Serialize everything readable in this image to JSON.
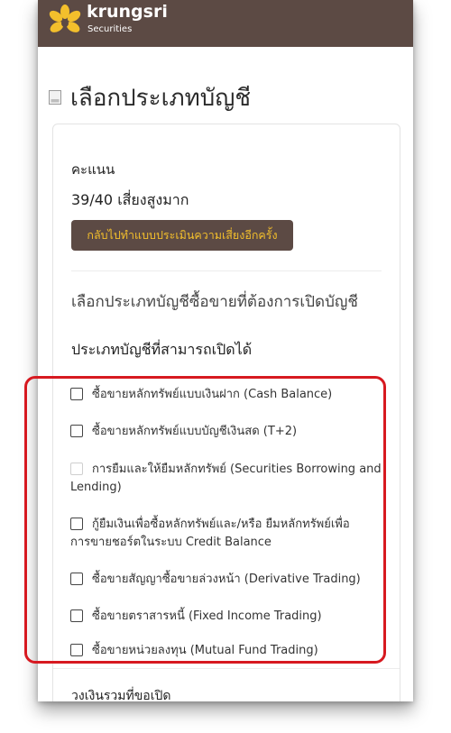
{
  "header": {
    "brand": "krungsri",
    "brand_sub": "Securities",
    "colors": {
      "header_bg": "#5c4a44",
      "logo_yellow": "#f3bf2c"
    }
  },
  "page": {
    "title": "เลือกประเภทบัญชี",
    "title_icon": "document-icon"
  },
  "score": {
    "label": "คะแนน",
    "value": "39/40 เสี่ยงสูงมาก",
    "retake_button": "กลับไปทำแบบประเมินความเสี่ยงอีกครั้ง"
  },
  "account": {
    "instruction": "เลือกประเภทบัญชีซื้อขายที่ต้องการเปิดบัญชี",
    "section_title": "ประเภทบัญชีที่สามารถเปิดได้",
    "highlight_color": "#d71920",
    "options": [
      {
        "line1": "ซื้อขายหลักทรัพย์แบบเงินฝาก (Cash Balance)",
        "line2": "",
        "checked": false,
        "disabled": false
      },
      {
        "line1": "ซื้อขายหลักทรัพย์แบบบัญชีเงินสด (T+2)",
        "line2": "",
        "checked": false,
        "disabled": false
      },
      {
        "line1": "การยืมและให้ยืมหลักทรัพย์ (Securities Borrowing and",
        "line2": "Lending)",
        "checked": false,
        "disabled": true
      },
      {
        "line1": "กู้ยืมเงินเพื่อซื้อหลักทรัพย์และ/หรือ ยืมหลักทรัพย์เพื่อ",
        "line2": "การขายชอร์ตในระบบ Credit Balance",
        "checked": false,
        "disabled": false
      },
      {
        "line1": "ซื้อขายสัญญาซื้อขายล่วงหน้า (Derivative Trading)",
        "line2": "",
        "checked": false,
        "disabled": false
      },
      {
        "line1": "ซื้อขายตราสารหนี้ (Fixed Income Trading)",
        "line2": "",
        "checked": false,
        "disabled": false
      },
      {
        "line1": "ซื้อขายหน่วยลงทุน (Mutual Fund Trading)",
        "line2": "",
        "checked": false,
        "disabled": false
      }
    ]
  },
  "budget": {
    "label": "วงเงินรวมที่ขอเปิด"
  }
}
